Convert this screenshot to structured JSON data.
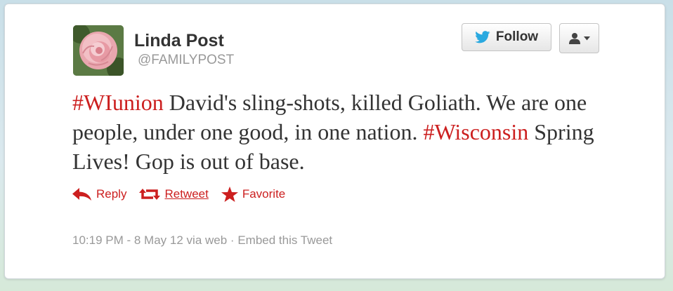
{
  "user": {
    "name": "Linda Post",
    "handle": "@FAMILYPOST"
  },
  "header": {
    "follow_label": "Follow"
  },
  "tweet": {
    "segments": [
      {
        "type": "hashtag",
        "text": "#WIunion"
      },
      {
        "type": "text",
        "text": " David's sling-shots, killed Goliath. We are one people, under one good, in one nation. "
      },
      {
        "type": "hashtag",
        "text": "#Wisconsin"
      },
      {
        "type": "text",
        "text": " Spring Lives! Gop is out of base."
      }
    ]
  },
  "actions": {
    "reply_label": "Reply",
    "retweet_label": "Retweet",
    "favorite_label": "Favorite"
  },
  "meta": {
    "timestamp": "10:19 PM - 8 May 12",
    "via": "via web",
    "separator": "·",
    "embed_label": "Embed this Tweet"
  },
  "colors": {
    "accent_red": "#cc1f1f",
    "twitter_blue": "#2aa9e0",
    "text_dark": "#333333",
    "text_muted": "#999999"
  },
  "icons": {
    "follow": "twitter-bird-icon",
    "user_menu": "user-icon",
    "reply": "reply-arrow-icon",
    "retweet": "retweet-icon",
    "favorite": "star-icon"
  }
}
